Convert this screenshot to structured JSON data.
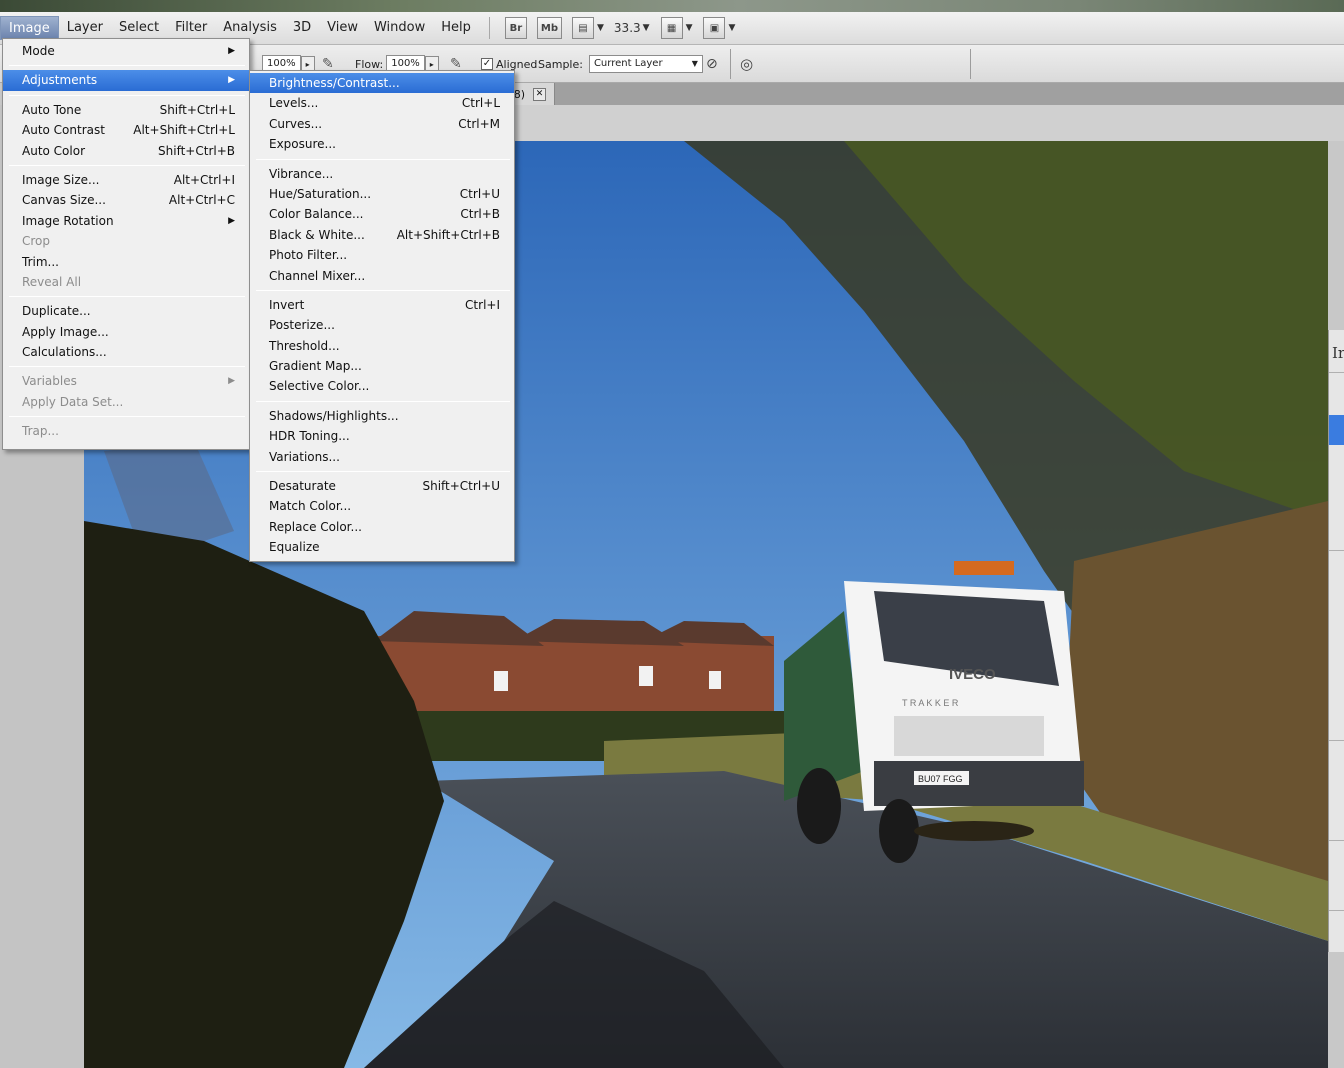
{
  "menubar": {
    "items": [
      "Image",
      "Layer",
      "Select",
      "Filter",
      "Analysis",
      "3D",
      "View",
      "Window",
      "Help"
    ],
    "active_index": 0,
    "bridge_label": "Br",
    "minibridge_label": "Mb",
    "zoom_value": "33.3"
  },
  "options": {
    "opacity_value": "100%",
    "flow_label": "Flow:",
    "flow_value": "100%",
    "aligned_label": "Aligned",
    "aligned_checked": "✓",
    "sample_label": "Sample:",
    "sample_value": "Current Layer"
  },
  "doc_tab": {
    "title_fragment": "/8)",
    "close_label": "✕"
  },
  "right_panel": {
    "label_fragment": "Ir"
  },
  "image_menu": {
    "items": [
      {
        "label": "Mode",
        "shortcut": "",
        "submenu": true,
        "disabled": false
      },
      {
        "sep": true
      },
      {
        "label": "Adjustments",
        "shortcut": "",
        "submenu": true,
        "disabled": false,
        "highlighted": true
      },
      {
        "sep": true
      },
      {
        "label": "Auto Tone",
        "shortcut": "Shift+Ctrl+L"
      },
      {
        "label": "Auto Contrast",
        "shortcut": "Alt+Shift+Ctrl+L"
      },
      {
        "label": "Auto Color",
        "shortcut": "Shift+Ctrl+B"
      },
      {
        "sep": true
      },
      {
        "label": "Image Size...",
        "shortcut": "Alt+Ctrl+I"
      },
      {
        "label": "Canvas Size...",
        "shortcut": "Alt+Ctrl+C"
      },
      {
        "label": "Image Rotation",
        "shortcut": "",
        "submenu": true
      },
      {
        "label": "Crop",
        "shortcut": "",
        "disabled": true
      },
      {
        "label": "Trim...",
        "shortcut": ""
      },
      {
        "label": "Reveal All",
        "shortcut": "",
        "disabled": true
      },
      {
        "sep": true
      },
      {
        "label": "Duplicate...",
        "shortcut": ""
      },
      {
        "label": "Apply Image...",
        "shortcut": ""
      },
      {
        "label": "Calculations...",
        "shortcut": ""
      },
      {
        "sep": true
      },
      {
        "label": "Variables",
        "shortcut": "",
        "submenu": true,
        "disabled": true
      },
      {
        "label": "Apply Data Set...",
        "shortcut": "",
        "disabled": true
      },
      {
        "sep": true
      },
      {
        "label": "Trap...",
        "shortcut": "",
        "disabled": true
      }
    ]
  },
  "adjustments_menu": {
    "items": [
      {
        "label": "Brightness/Contrast...",
        "shortcut": "",
        "highlighted": true
      },
      {
        "label": "Levels...",
        "shortcut": "Ctrl+L"
      },
      {
        "label": "Curves...",
        "shortcut": "Ctrl+M"
      },
      {
        "label": "Exposure...",
        "shortcut": ""
      },
      {
        "sep": true
      },
      {
        "label": "Vibrance...",
        "shortcut": ""
      },
      {
        "label": "Hue/Saturation...",
        "shortcut": "Ctrl+U"
      },
      {
        "label": "Color Balance...",
        "shortcut": "Ctrl+B"
      },
      {
        "label": "Black & White...",
        "shortcut": "Alt+Shift+Ctrl+B"
      },
      {
        "label": "Photo Filter...",
        "shortcut": ""
      },
      {
        "label": "Channel Mixer...",
        "shortcut": ""
      },
      {
        "sep": true
      },
      {
        "label": "Invert",
        "shortcut": "Ctrl+I"
      },
      {
        "label": "Posterize...",
        "shortcut": ""
      },
      {
        "label": "Threshold...",
        "shortcut": ""
      },
      {
        "label": "Gradient Map...",
        "shortcut": ""
      },
      {
        "label": "Selective Color...",
        "shortcut": ""
      },
      {
        "sep": true
      },
      {
        "label": "Shadows/Highlights...",
        "shortcut": ""
      },
      {
        "label": "HDR Toning...",
        "shortcut": ""
      },
      {
        "label": "Variations...",
        "shortcut": ""
      },
      {
        "sep": true
      },
      {
        "label": "Desaturate",
        "shortcut": "Shift+Ctrl+U"
      },
      {
        "label": "Match Color...",
        "shortcut": ""
      },
      {
        "label": "Replace Color...",
        "shortcut": ""
      },
      {
        "label": "Equalize",
        "shortcut": ""
      }
    ]
  },
  "photo": {
    "truck_brand": "IVECO",
    "truck_model": "T R A K K E R",
    "plate": "BU07 FGG"
  },
  "colors": {
    "highlight": "#2f72d8",
    "sky_top": "#2f6fc0",
    "sky_bottom": "#7fb4e4"
  }
}
